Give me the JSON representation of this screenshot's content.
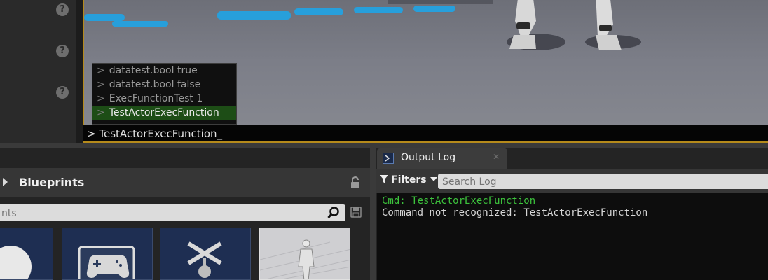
{
  "colors": {
    "accent_gold": "#b58a1b",
    "cmd_green": "#3cc23c",
    "selected_row": "#1d4d16",
    "viewport_blue_stripe": "#1fa4e6"
  },
  "details_panel": {
    "help_icons": [
      "?",
      "?",
      "?"
    ]
  },
  "console": {
    "suggestions": [
      {
        "prefix": ">",
        "text": "datatest.bool true",
        "selected": false
      },
      {
        "prefix": ">",
        "text": "datatest.bool false",
        "selected": false
      },
      {
        "prefix": ">",
        "text": "ExecFunctionTest 1",
        "selected": false
      },
      {
        "prefix": ">",
        "text": "TestActorExecFunction",
        "selected": true
      }
    ],
    "input_prefix": ">",
    "input_value": "TestActorExecFunction_"
  },
  "content_browser": {
    "title": "Blueprints",
    "search_placeholder": "nts",
    "icons": {
      "lock": "lock-open-icon",
      "search": "magnifier-icon",
      "save": "save-icon"
    }
  },
  "output_log": {
    "tab_label": "Output Log",
    "filters_label": "Filters",
    "search_placeholder": "Search Log",
    "lines": [
      {
        "text": "Cmd: TestActorExecFunction",
        "color": "#3cc23c"
      },
      {
        "text": "Command not recognized: TestActorExecFunction",
        "color": "#d6d6d6"
      }
    ]
  }
}
